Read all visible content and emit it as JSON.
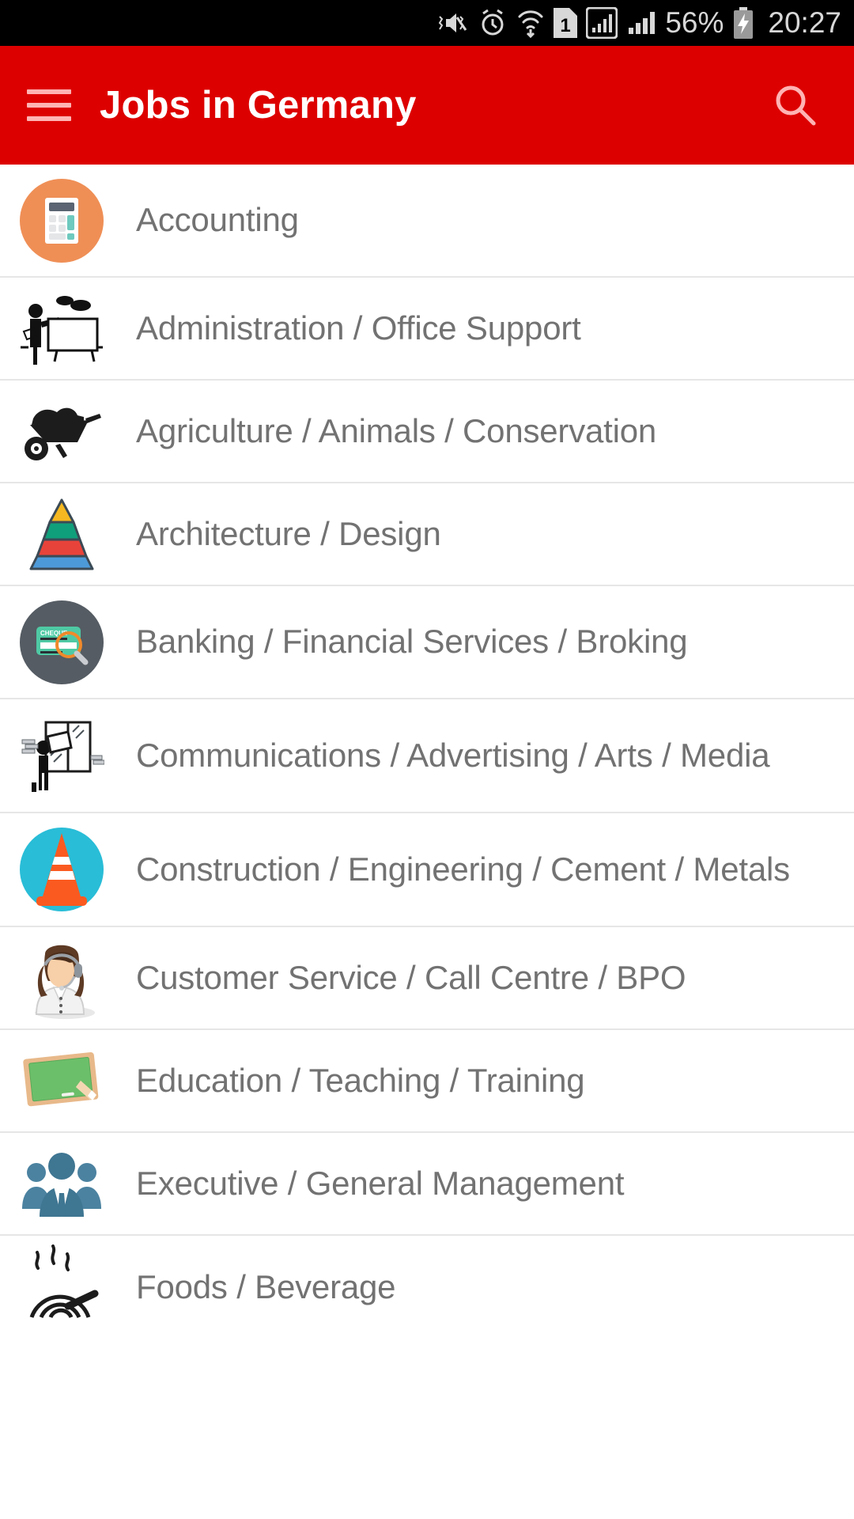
{
  "status_bar": {
    "icons": [
      "vibrate-mute-icon",
      "alarm-icon",
      "wifi-icon",
      "sim-1-icon",
      "signal-sim1-icon",
      "signal-sim2-icon"
    ],
    "battery_percent": "56%",
    "battery_icon": "battery-charging-icon",
    "time": "20:27"
  },
  "app_bar": {
    "menu_icon": "hamburger-menu-icon",
    "title": "Jobs in Germany",
    "search_icon": "search-icon",
    "background_color": "#dd0000",
    "title_color": "#ffffff"
  },
  "list": {
    "items": [
      {
        "label": "Accounting",
        "icon": "calculator-icon"
      },
      {
        "label": "Administration / Office Support",
        "icon": "presenter-whiteboard-icon"
      },
      {
        "label": "Agriculture / Animals / Conservation",
        "icon": "wheelbarrow-icon"
      },
      {
        "label": "Architecture / Design",
        "icon": "pyramid-chart-icon"
      },
      {
        "label": "Banking / Financial Services / Broking",
        "icon": "cheque-magnifier-icon"
      },
      {
        "label": "Communications / Advertising / Arts / Media",
        "icon": "poster-hanging-icon"
      },
      {
        "label": "Construction / Engineering / Cement / Metals",
        "icon": "traffic-cone-icon"
      },
      {
        "label": "Customer Service / Call Centre / BPO",
        "icon": "headset-agent-icon"
      },
      {
        "label": "Education / Teaching / Training",
        "icon": "chalkboard-icon"
      },
      {
        "label": "Executive / General Management",
        "icon": "business-people-icon"
      },
      {
        "label": "Foods / Beverage",
        "icon": "steaming-dish-icon"
      }
    ]
  },
  "colors": {
    "accent_red": "#dd0000",
    "label_gray": "#727272",
    "divider": "#e6e6e6",
    "accounting_circle": "#ef8f56",
    "banking_circle": "#555c63",
    "construction_circle": "#29bdd7"
  }
}
